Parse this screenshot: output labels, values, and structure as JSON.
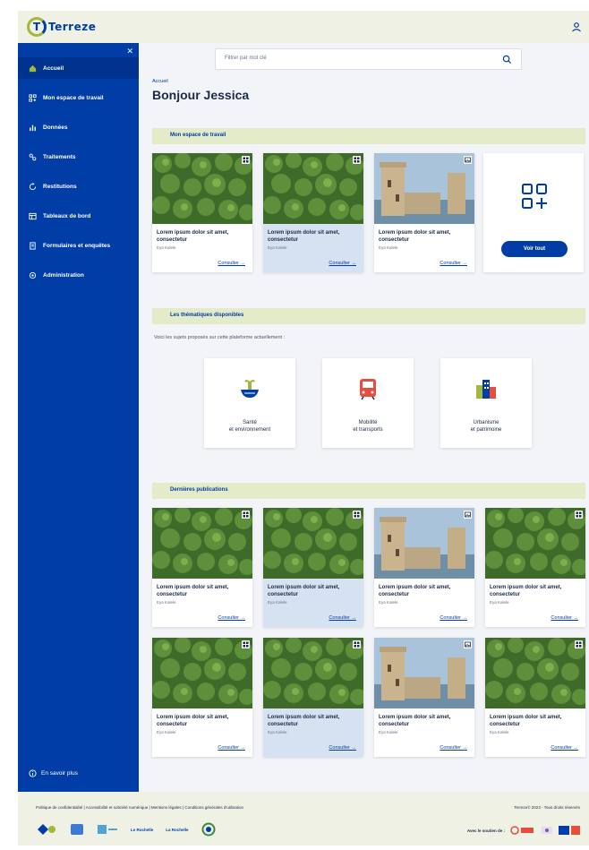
{
  "app": {
    "logo_text": "Terreze",
    "logo_letter": "T"
  },
  "sidebar": {
    "items": [
      {
        "label": "Accueil",
        "icon": "home-icon",
        "active": true
      },
      {
        "label": "Mon espace de travail",
        "icon": "workspace-icon",
        "active": false
      },
      {
        "label": "Données",
        "icon": "data-icon",
        "active": false
      },
      {
        "label": "Traitements",
        "icon": "processing-icon",
        "active": false
      },
      {
        "label": "Restitutions",
        "icon": "restitution-icon",
        "active": false
      },
      {
        "label": "Tableaux de bord",
        "icon": "dashboard-icon",
        "active": false
      },
      {
        "label": "Formulaires et enquêtes",
        "icon": "forms-icon",
        "active": false
      },
      {
        "label": "Administration",
        "icon": "admin-icon",
        "active": false
      }
    ],
    "footer_label": "En savoir plus"
  },
  "search": {
    "placeholder": "Filtrer par mot clé"
  },
  "main": {
    "breadcrumb": "Accueil",
    "title": "Bonjour Jessica",
    "workspace_section": "Mon espace de travail",
    "themes_section": "Les thématiques disponibles",
    "themes_intro": "Voici les sujets proposés sur cette plateforme actuellement :",
    "publications_section": "Dernières publications",
    "see_all": "Voir tout"
  },
  "card_text": {
    "title": "Lorem ipsum dolor sit amet, consectetur",
    "meta": "Eya Kalele",
    "link": "Consulter →"
  },
  "themes": [
    {
      "label": "Santé\net environnement",
      "icon": "health-environment-icon"
    },
    {
      "label": "Mobilité\net transports",
      "icon": "mobility-icon"
    },
    {
      "label": "Urbanisme\net patrimoine",
      "icon": "urbanism-icon"
    }
  ],
  "footer": {
    "links": "Politique de confidentialité  |  Accessibilité et sobriété numérique  |  Mentions légales  |  Conditions générales d'utilisation",
    "copyright": "Terreze© 2023 - Tous droits réservés",
    "support_label": "Avec le soutien de :",
    "partner_logo_text": [
      "Le Rochelle",
      "La Rochelle"
    ]
  },
  "colors": {
    "primary": "#003da6",
    "accent": "#a3b83a",
    "section": "#e3ebc8"
  }
}
